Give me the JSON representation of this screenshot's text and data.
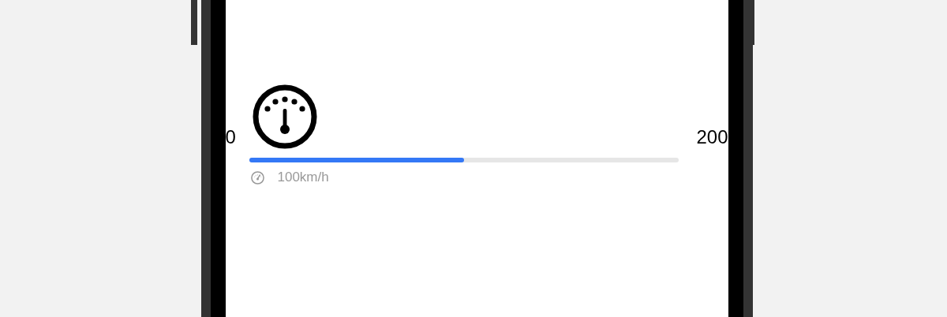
{
  "speed_gauge": {
    "min_label": "0",
    "max_label": "200",
    "level": 0.5,
    "reading": "100km/h"
  }
}
